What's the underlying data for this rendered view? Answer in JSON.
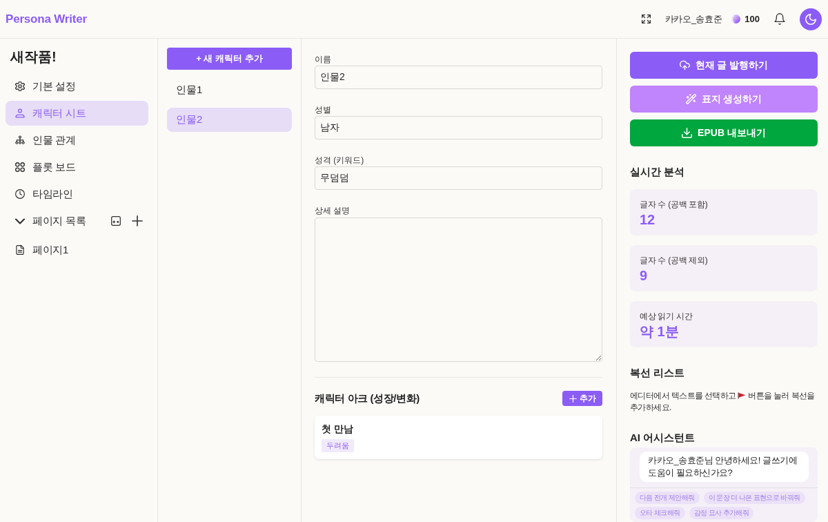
{
  "header": {
    "logo": "Persona Writer",
    "username": "카카오_송효준",
    "credits": "100"
  },
  "sidebar": {
    "title": "새작품!",
    "items": [
      {
        "kind": "settings",
        "label": "기본 설정",
        "selected": false
      },
      {
        "kind": "characters",
        "label": "캐릭터 시트",
        "selected": true
      },
      {
        "kind": "relations",
        "label": "인물 관계",
        "selected": false
      },
      {
        "kind": "plot",
        "label": "플롯 보드",
        "selected": false
      },
      {
        "kind": "timeline",
        "label": "타임라인",
        "selected": false
      }
    ]
  },
  "page_list": {
    "label": "페이지 목록",
    "expanded": true,
    "pages": [
      {
        "label": "페이지1",
        "selected": false
      }
    ]
  },
  "characters": {
    "add_button": "+ 새 캐릭터 추가",
    "items": [
      {
        "label": "인물1",
        "selected": false
      },
      {
        "label": "인물2",
        "selected": true
      }
    ]
  },
  "form": {
    "fields": [
      {
        "kind": "input",
        "label": "이름",
        "value": "인물2"
      },
      {
        "kind": "input",
        "label": "성별",
        "value": "남자"
      },
      {
        "kind": "input",
        "label": "성격 (키워드)",
        "value": "무덤덤"
      },
      {
        "kind": "textarea",
        "label": "상세 설명"
      }
    ],
    "arc": {
      "title": "캐릭터 아크 (성장/변화)",
      "add_button": "추가",
      "cards": [
        {
          "title": "첫 만남",
          "tags": [
            "두려움"
          ]
        }
      ]
    }
  },
  "actions": [
    {
      "kind": "publish",
      "label": "현재 글 발행하기"
    },
    {
      "kind": "cover",
      "label": "표지 생성하기"
    },
    {
      "kind": "export",
      "label": "EPUB 내보내기"
    }
  ],
  "analysis": {
    "title": "실시간 분석",
    "stats": [
      {
        "label": "글자 수 (공백 포함)",
        "value": "12"
      },
      {
        "label": "글자 수 (공백 제외)",
        "value": "9"
      },
      {
        "label": "예상 읽기 시간",
        "value": "약 1분"
      }
    ]
  },
  "foreshadowing": {
    "title": "복선 리스트",
    "hint_before_icon": "에디터에서 텍스트를 선택하고",
    "hint_after_icon": "버튼을 눌러 복선을 추가하세요."
  },
  "assistant": {
    "title": "AI 어시스턴트",
    "messages": [
      {
        "text": "카카오_송효준님 안녕하세요! 글쓰기에 도움이 필요하신가요?"
      }
    ],
    "suggestions": [
      "다음 전개 제안해줘",
      "이 문장 더 나은 표현으로 바꿔줘",
      "오타 체크해줘",
      "감정 묘사 추가해줘"
    ]
  }
}
